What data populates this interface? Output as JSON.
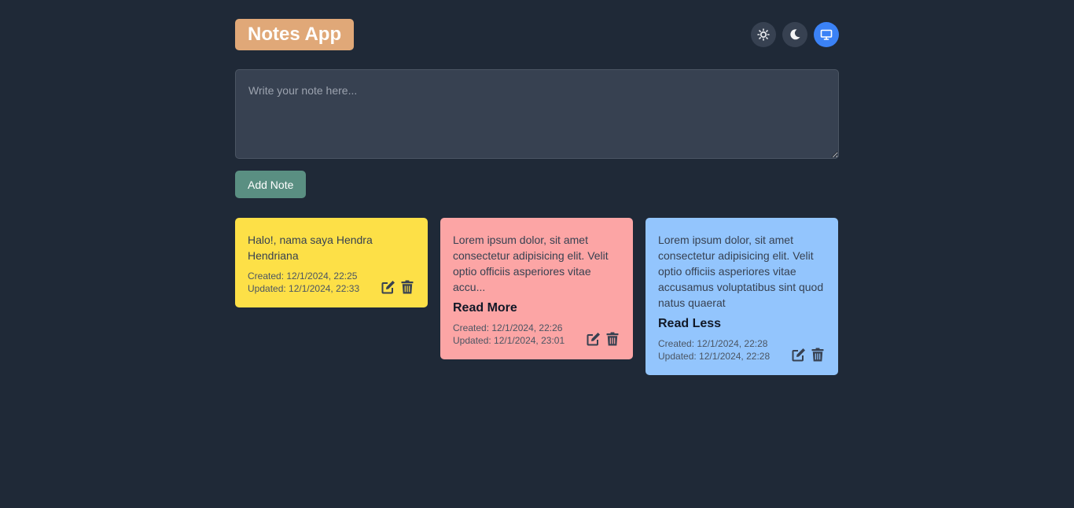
{
  "header": {
    "title": "Notes App",
    "theme_buttons": [
      {
        "icon": "sun-icon",
        "active": false
      },
      {
        "icon": "moon-icon",
        "active": false
      },
      {
        "icon": "monitor-icon",
        "active": true
      }
    ]
  },
  "composer": {
    "placeholder": "Write your note here...",
    "value": "",
    "add_label": "Add Note"
  },
  "notes": [
    {
      "color": "#fde047",
      "text": "Halo!, nama saya Hendra Hendriana",
      "toggle": "",
      "created": "Created: 12/1/2024, 22:25",
      "updated": "Updated: 12/1/2024, 22:33"
    },
    {
      "color": "#fca5a5",
      "text": "Lorem ipsum dolor, sit amet consectetur adipisicing elit. Velit optio officiis asperiores vitae accu...",
      "toggle": "Read More",
      "created": "Created: 12/1/2024, 22:26",
      "updated": "Updated: 12/1/2024, 23:01"
    },
    {
      "color": "#93c5fd",
      "text": "Lorem ipsum dolor, sit amet consectetur adipisicing elit. Velit optio officiis asperiores vitae accusamus voluptatibus sint quod natus quaerat",
      "toggle": "Read Less",
      "created": "Created: 12/1/2024, 22:28",
      "updated": "Updated: 12/1/2024, 22:28"
    }
  ],
  "colors": {
    "background": "#1f2937",
    "title_bg": "#e0a878",
    "add_button": "#5a8f82",
    "active_theme": "#3b82f6"
  }
}
